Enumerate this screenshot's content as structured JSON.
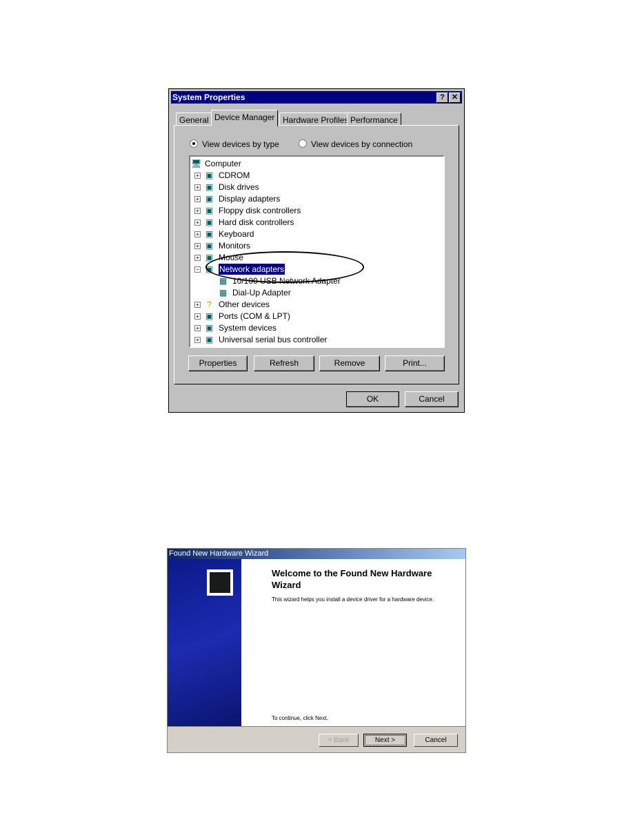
{
  "system_properties": {
    "title": "System Properties",
    "help_btn": "?",
    "close_btn": "✕",
    "tabs": [
      "General",
      "Device Manager",
      "Hardware Profiles",
      "Performance"
    ],
    "active_tab": "Device Manager",
    "radio_type": "View devices by type",
    "radio_connection": "View devices by connection",
    "tree": {
      "root": "Computer",
      "items": [
        "CDROM",
        "Disk drives",
        "Display adapters",
        "Floppy disk controllers",
        "Hard disk controllers",
        "Keyboard",
        "Monitors",
        "Mouse",
        "Network adapters"
      ],
      "network_children": [
        "10/100 USB Network Adapter",
        "Dial-Up Adapter"
      ],
      "items_after": [
        "Other devices",
        "Ports (COM & LPT)",
        "System devices",
        "Universal serial bus controller"
      ],
      "selected": "Network adapters"
    },
    "buttons": {
      "properties": "Properties",
      "refresh": "Refresh",
      "remove": "Remove",
      "print": "Print...",
      "ok": "OK",
      "cancel": "Cancel"
    }
  },
  "wizard": {
    "title": "Found New Hardware Wizard",
    "heading": "Welcome to the Found New Hardware Wizard",
    "body": "This wizard helps you install a device driver for a hardware device.",
    "continue": "To continue, click Next.",
    "buttons": {
      "back": "< Back",
      "next": "Next >",
      "cancel": "Cancel"
    }
  },
  "colors": {
    "titlebar": "#000080",
    "selection": "#000080",
    "face": "#c0c0c0"
  }
}
